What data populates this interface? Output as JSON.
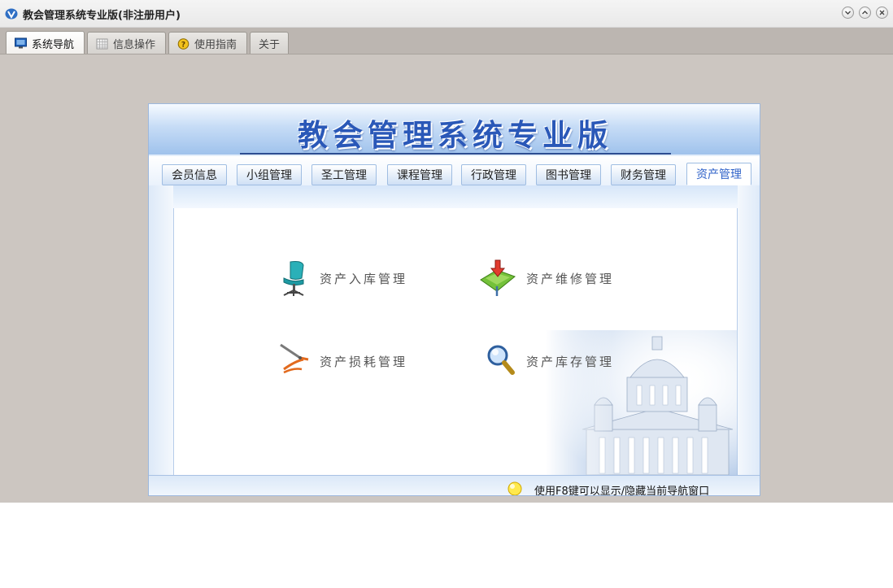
{
  "window": {
    "title": "教会管理系统专业版(非注册用户)"
  },
  "tabs": [
    {
      "label": "系统导航",
      "icon": "monitor-icon",
      "active": true
    },
    {
      "label": "信息操作",
      "icon": "grid-icon",
      "active": false
    },
    {
      "label": "使用指南",
      "icon": "help-icon",
      "active": false
    },
    {
      "label": "关于",
      "icon": "",
      "active": false
    }
  ],
  "panel": {
    "banner_title": "教会管理系统专业版",
    "nav_tabs": [
      {
        "label": "会员信息",
        "active": false
      },
      {
        "label": "小组管理",
        "active": false
      },
      {
        "label": "圣工管理",
        "active": false
      },
      {
        "label": "课程管理",
        "active": false
      },
      {
        "label": "行政管理",
        "active": false
      },
      {
        "label": "图书管理",
        "active": false
      },
      {
        "label": "财务管理",
        "active": false
      },
      {
        "label": "资产管理",
        "active": true
      }
    ],
    "items": [
      {
        "label": "资产入库管理",
        "icon": "office-chair-icon"
      },
      {
        "label": "资产维修管理",
        "icon": "repair-tools-icon"
      },
      {
        "label": "资产损耗管理",
        "icon": "pliers-icon"
      },
      {
        "label": "资产库存管理",
        "icon": "magnifier-icon"
      }
    ],
    "tip": "使用F8键可以显示/隐藏当前导航窗口"
  },
  "colors": {
    "accent_blue": "#3063c9",
    "banner_text": "#2a58b8",
    "window_bg": "#ccc6c1"
  }
}
